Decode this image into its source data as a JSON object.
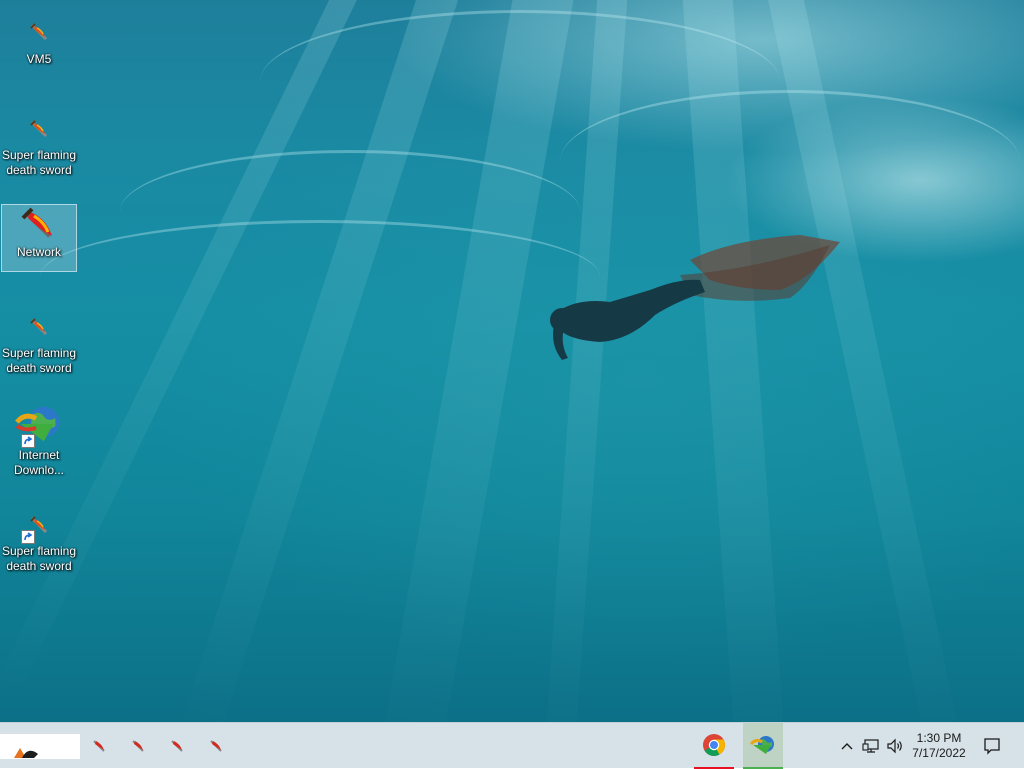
{
  "desktop": {
    "wallpaper": "underwater-freediver",
    "icons": [
      {
        "label": "VM5",
        "icon": "flaming-sword-icon",
        "selected": false,
        "shortcut": false
      },
      {
        "label": "Super flaming death sword",
        "icon": "flaming-sword-icon",
        "selected": false,
        "shortcut": false
      },
      {
        "label": "Network",
        "icon": "network-sword-icon",
        "selected": true,
        "shortcut": false
      },
      {
        "label": "Super flaming death sword",
        "icon": "flaming-sword-icon",
        "selected": false,
        "shortcut": false
      },
      {
        "label": "Internet Downlo...",
        "icon": "internet-download-manager-icon",
        "selected": false,
        "shortcut": true
      },
      {
        "label": "Super flaming death sword",
        "icon": "flaming-sword-icon",
        "selected": false,
        "shortcut": true
      }
    ]
  },
  "taskbar": {
    "pinned_small": [
      "flaming-sword-icon",
      "flaming-sword-icon",
      "flaming-sword-icon",
      "flaming-sword-icon"
    ],
    "apps": [
      {
        "icon": "chrome-icon",
        "active": true,
        "indicator_color": "#e81123"
      },
      {
        "icon": "internet-download-manager-icon",
        "active": true,
        "indicator_color": "#4caf50"
      }
    ],
    "tray": {
      "show_hidden_icon": "chevron-up-icon",
      "network_icon": "network-icon",
      "volume_icon": "volume-icon",
      "time": "1:30 PM",
      "date": "7/17/2022",
      "notification_icon": "notification-icon"
    }
  },
  "colors": {
    "taskbar_bg": "#d6e1e8",
    "water_top": "#1e7f9b",
    "water_bottom": "#0c7087"
  }
}
